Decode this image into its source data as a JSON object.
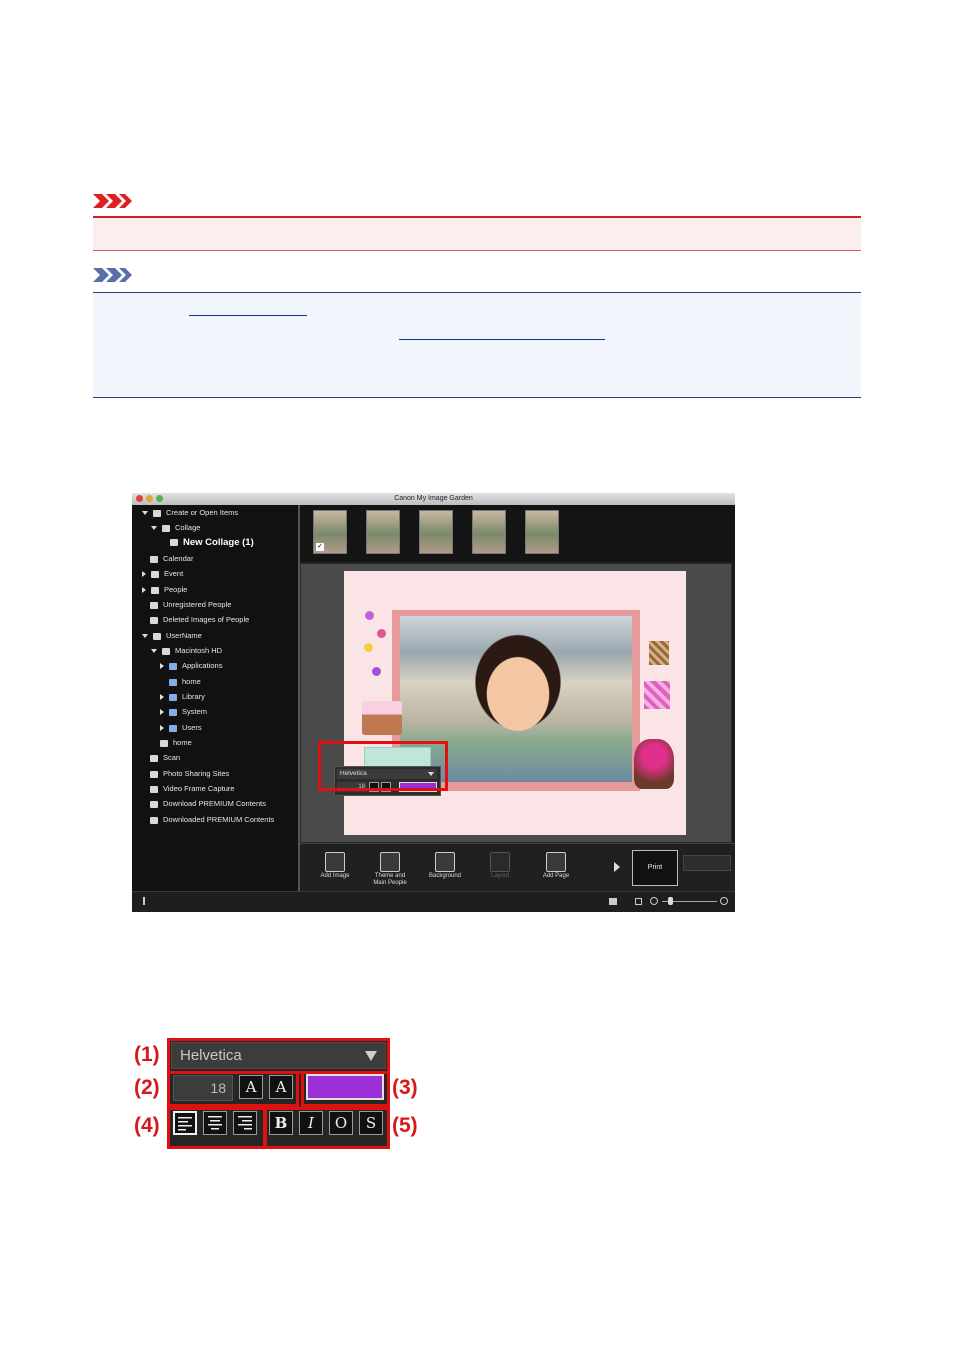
{
  "window": {
    "title": "Canon My Image Garden"
  },
  "sidebar": {
    "items": [
      {
        "label": "Create or Open Items"
      },
      {
        "label": "Collage"
      },
      {
        "label": "New Collage (1)"
      },
      {
        "label": "Calendar"
      },
      {
        "label": "Event"
      },
      {
        "label": "People"
      },
      {
        "label": "Unregistered People"
      },
      {
        "label": "Deleted Images of People"
      },
      {
        "label": "UserName"
      },
      {
        "label": "Macintosh HD"
      },
      {
        "label": "Applications"
      },
      {
        "label": "home"
      },
      {
        "label": "Library"
      },
      {
        "label": "System"
      },
      {
        "label": "Users"
      },
      {
        "label": "home"
      },
      {
        "label": "Scan"
      },
      {
        "label": "Photo Sharing Sites"
      },
      {
        "label": "Video Frame Capture"
      },
      {
        "label": "Download PREMIUM Contents"
      },
      {
        "label": "Downloaded PREMIUM Contents"
      }
    ]
  },
  "toolbar": {
    "add_image": "Add Image",
    "theme_line1": "Theme and",
    "theme_line2": "Main People",
    "background": "Background",
    "layout": "Layout",
    "add_page": "Add Page",
    "print": "Print"
  },
  "mini_popup": {
    "font": "Helvetica",
    "size": "18",
    "color": "#9b30d8"
  },
  "palette": {
    "font": "Helvetica",
    "size": "18",
    "color": "#9b30d8",
    "bold": "B",
    "italic": "I",
    "outline": "O",
    "shadow": "S",
    "callouts": [
      "(1)",
      "(2)",
      "(3)",
      "(4)",
      "(5)"
    ]
  },
  "colors": {
    "important": "#cc2222",
    "note": "#2a3f7a",
    "highlight": "#e01010"
  }
}
